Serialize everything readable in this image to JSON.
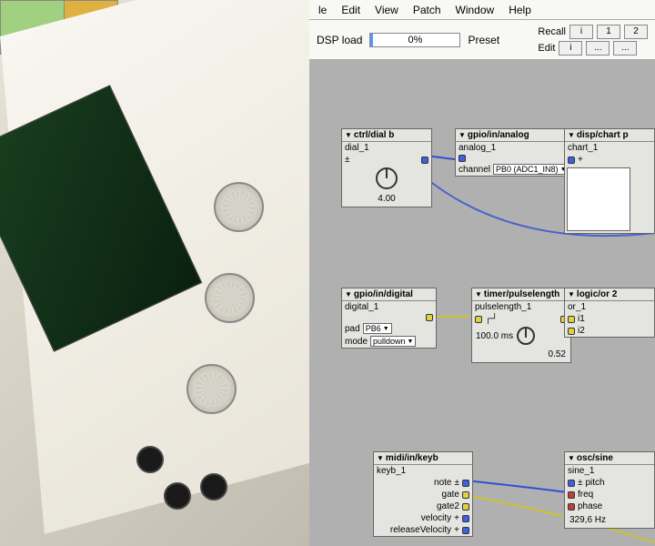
{
  "menu": {
    "items": [
      "le",
      "Edit",
      "View",
      "Patch",
      "Window",
      "Help"
    ]
  },
  "toolbar": {
    "dsp_label": "DSP load",
    "dsp_value": "0%",
    "preset_label": "Preset",
    "recall_label": "Recall",
    "edit_label": "Edit",
    "recall_buttons": [
      "i",
      "1",
      "2"
    ],
    "edit_buttons": [
      "i",
      "...",
      "..."
    ]
  },
  "nodes": {
    "dial": {
      "title": "ctrl/dial b",
      "name": "dial_1",
      "symbol": "±",
      "value": "4.00"
    },
    "analog": {
      "title": "gpio/in/analog",
      "name": "analog_1",
      "channel_label": "channel",
      "channel_value": "PB0 (ADC1_IN8)"
    },
    "chart": {
      "title": "disp/chart p",
      "name": "chart_1",
      "symbol": "+"
    },
    "digital": {
      "title": "gpio/in/digital",
      "name": "digital_1",
      "pad_label": "pad",
      "pad_value": "PB6",
      "mode_label": "mode",
      "mode_value": "pulldown"
    },
    "pulse": {
      "title": "timer/pulselength",
      "name": "pulselength_1",
      "time": "100.0 ms",
      "value": "0.52"
    },
    "logic": {
      "title": "logic/or 2",
      "name": "or_1",
      "i1": "i1",
      "i2": "i2"
    },
    "keyb": {
      "title": "midi/in/keyb",
      "name": "keyb_1",
      "ports": [
        "note",
        "gate",
        "gate2",
        "velocity",
        "releaseVelocity"
      ],
      "sym": [
        "±",
        "",
        "",
        "+",
        "+"
      ]
    },
    "sine": {
      "title": "osc/sine",
      "name": "sine_1",
      "ports": [
        "pitch",
        "freq",
        "phase"
      ],
      "sym": [
        "±",
        "",
        ""
      ],
      "freq": "329,6 Hz"
    }
  }
}
